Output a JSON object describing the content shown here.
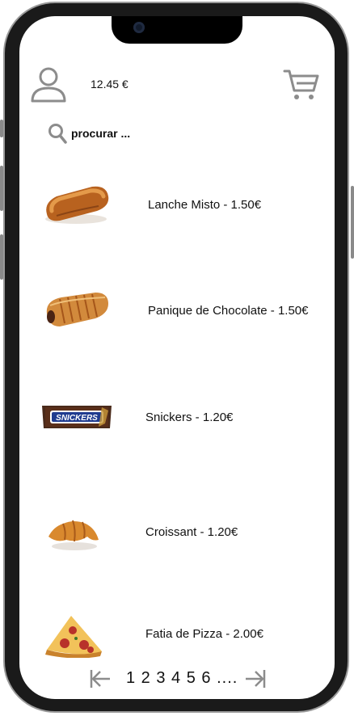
{
  "header": {
    "balance": "12.45 €",
    "icons": {
      "user": "user-icon",
      "cart": "cart-icon"
    }
  },
  "search": {
    "placeholder": "procurar ...",
    "icon": "search-icon"
  },
  "products": [
    {
      "label": "Lanche Misto - 1.50€",
      "image": "bread-roll"
    },
    {
      "label": "Panique de Chocolate - 1.50€",
      "image": "pastry"
    },
    {
      "label": "Snickers - 1.20€",
      "image": "snickers-bar"
    },
    {
      "label": "Croissant - 1.20€",
      "image": "croissant"
    },
    {
      "label": "Fatia de Pizza - 2.00€",
      "image": "pizza-slice"
    }
  ],
  "pagination": {
    "pages": "1 2 3 4 5 6 ....",
    "prev_icon": "arrow-first-icon",
    "next_icon": "arrow-last-icon"
  },
  "snickers_brand": "SNICKERS",
  "colors": {
    "icon_gray": "#8c8c8c",
    "text": "#111111"
  }
}
